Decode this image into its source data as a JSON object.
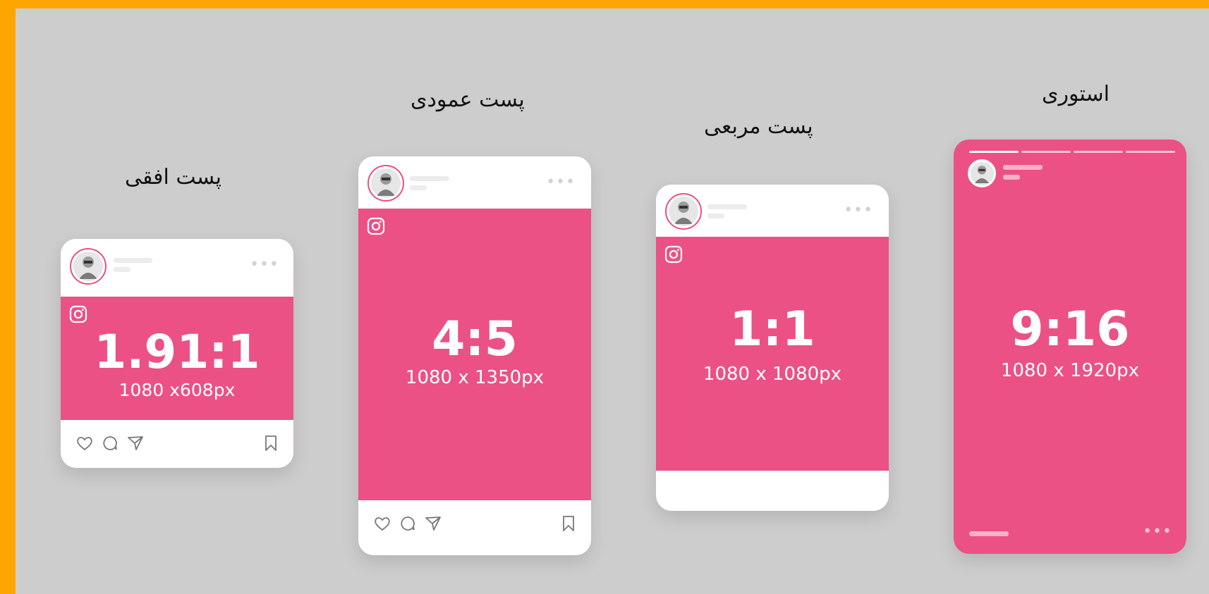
{
  "posts": {
    "landscape": {
      "heading": "پست افقی",
      "ratio": "1.91:1",
      "size": "1080 x608px"
    },
    "portrait": {
      "heading": "پست عمودی",
      "ratio": "4:5",
      "size": "1080 x 1350px"
    },
    "square": {
      "heading": "پست مربعی",
      "ratio": "1:1",
      "size": "1080 x 1080px"
    },
    "story": {
      "heading": "استوری",
      "ratio": "9:16",
      "size": "1080 x 1920px"
    }
  },
  "icons": {
    "more": "more-dots-icon",
    "instagram": "instagram-icon",
    "heart": "heart-icon",
    "comment": "comment-icon",
    "share": "send-icon",
    "bookmark": "bookmark-icon"
  },
  "colors": {
    "frame": "#ffa500",
    "background": "#cecdcd",
    "accent": "#eb5185",
    "card": "#ffffff"
  }
}
